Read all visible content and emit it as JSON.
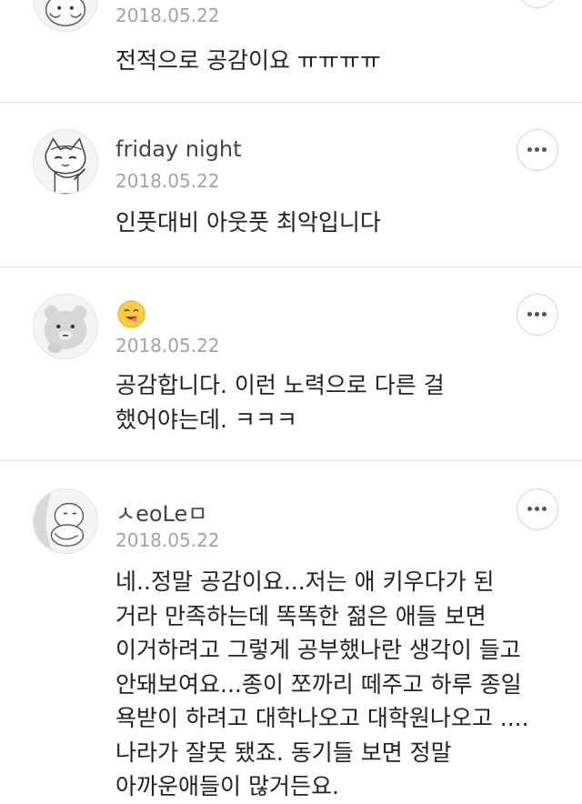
{
  "comments": [
    {
      "author": "",
      "date": "2018.05.22",
      "text": "전적으로 공감이요 ㅠㅠㅠㅠ",
      "avatar_icon": "cat-character-avatar-icon"
    },
    {
      "author": "friday night",
      "date": "2018.05.22",
      "text": "인풋대비 아웃풋 최악입니다",
      "avatar_icon": "cat-character-avatar-icon"
    },
    {
      "author_icon": "smiling-emoji-icon",
      "date": "2018.05.22",
      "text": "공감합니다. 이런 노력으로 다른 걸 했어야는데. ㅋㅋㅋ",
      "avatar_icon": "bear-character-avatar-icon"
    },
    {
      "author": "ㅅeoLeㅁ",
      "date": "2018.05.22",
      "text": "네..정말 공감이요...저는 애 키우다가 된 거라 만족하는데 똑똑한 젊은 애들 보면 이거하려고 그렇게 공부했나란 생각이 들고 안돼보여요...종이 쪼까리 떼주고 하루 종일 욕받이 하려고 대학나오고 대학원나오고 ....나라가 잘못 됐죠. 동기들 보면 정말 아까운애들이 많거든요.",
      "avatar_icon": "character-avatar-icon"
    }
  ],
  "more_button_icon": "more-options-icon",
  "colors": {
    "divider": "#e2e2e2",
    "date_text": "#a3a3a3",
    "body_text": "#222222"
  }
}
